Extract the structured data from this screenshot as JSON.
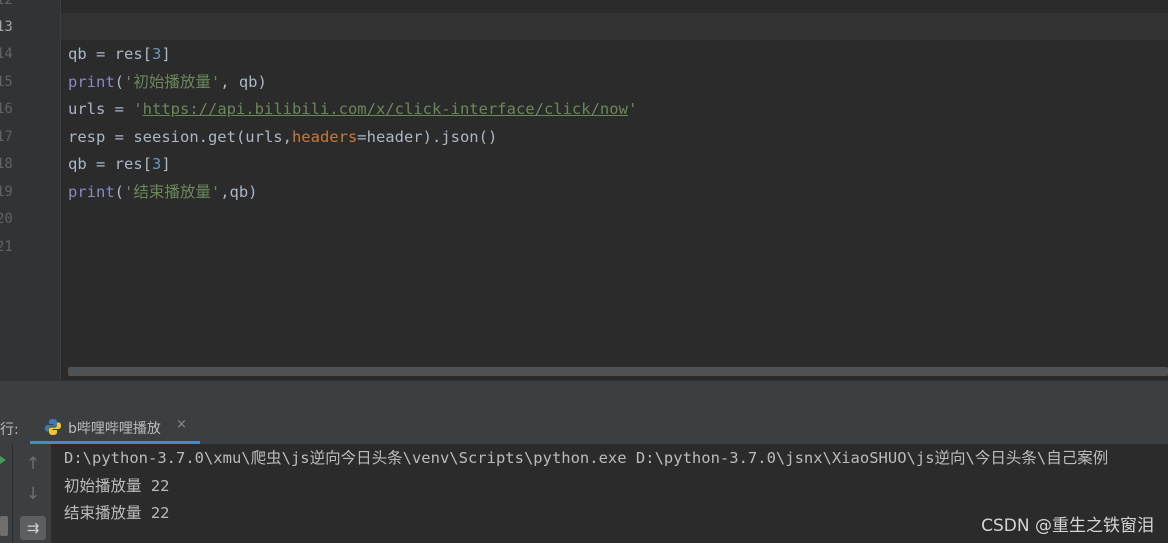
{
  "editor": {
    "line_numbers": [
      "12",
      "13",
      "14",
      "15",
      "16",
      "17",
      "18",
      "19",
      "20",
      "21"
    ],
    "current_line": "13",
    "lines": {
      "l14": {
        "a": "qb = res[",
        "num": "3",
        "b": "]"
      },
      "l15": {
        "fn": "print",
        "a": "(",
        "str": "'初始播放量'",
        "b": ", qb)"
      },
      "l16": {
        "a": "urls = ",
        "q1": "'",
        "url": "https://api.bilibili.com/x/click-interface/click/now",
        "q2": "'"
      },
      "l17": {
        "a": "resp = seesion.get(urls,",
        "kw": "headers",
        "b": "=header).json()"
      },
      "l18": {
        "a": "qb = res[",
        "num": "3",
        "b": "]"
      },
      "l19": {
        "fn": "print",
        "a": "(",
        "str": "'结束播放量'",
        "b": ",qb)"
      }
    }
  },
  "run_panel": {
    "label": "行:",
    "tab_label": "b哔哩哔哩播放",
    "tab_close": "×",
    "console": [
      "D:\\python-3.7.0\\xmu\\爬虫\\js逆向今日头条\\venv\\Scripts\\python.exe D:\\python-3.7.0\\jsnx\\XiaoSHUO\\js逆向\\今日头条\\自己案例",
      "初始播放量 22",
      "结束播放量 22"
    ],
    "tools": {
      "up": "↑",
      "down": "↓",
      "wrap": "⇉"
    }
  },
  "icons": {
    "run": "run-icon",
    "python": "python-file-icon",
    "scroll_up": "arrow-up-icon",
    "scroll_down": "arrow-down-icon",
    "soft_wrap": "soft-wrap-icon"
  },
  "colors": {
    "editor_bg": "#2b2b2b",
    "string": "#6a8759",
    "keyword_arg": "#cc7832",
    "number": "#6897bb",
    "builtin": "#8888c6"
  },
  "watermark": "CSDN @重生之铁窗泪"
}
